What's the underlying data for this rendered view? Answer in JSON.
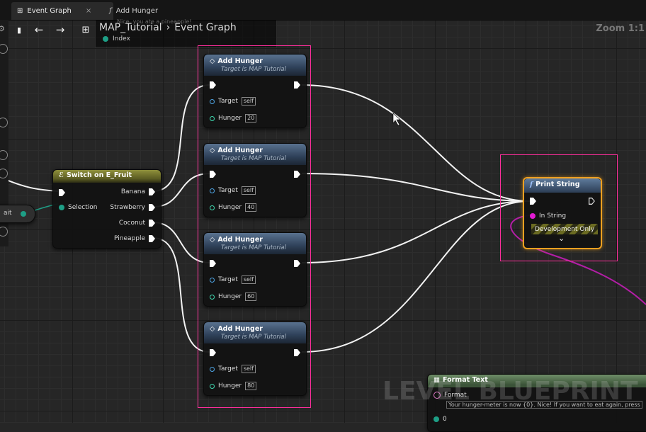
{
  "tabs": [
    {
      "label": "Event Graph",
      "close": "×"
    },
    {
      "label": "Add Hunger",
      "glyph": "f"
    }
  ],
  "breadcrumb": {
    "part1": "MAP_Tutorial",
    "separator": "›",
    "part2": "Event Graph"
  },
  "zoom": "Zoom 1:1",
  "popup": {
    "text": "Nice, you ate a pineapple!",
    "pin_label": "Index"
  },
  "left_stub": {
    "label": "ait"
  },
  "switch_node": {
    "title": "Switch on E_Fruit",
    "selection_label": "Selection",
    "outputs": [
      "Banana",
      "Strawberry",
      "Coconut",
      "Pineapple"
    ]
  },
  "add_hunger_nodes": [
    {
      "title": "Add Hunger",
      "subtitle": "Target is MAP Tutorial",
      "target_label": "Target",
      "target_value": "self",
      "hunger_label": "Hunger",
      "hunger_value": "20"
    },
    {
      "title": "Add Hunger",
      "subtitle": "Target is MAP Tutorial",
      "target_label": "Target",
      "target_value": "self",
      "hunger_label": "Hunger",
      "hunger_value": "40"
    },
    {
      "title": "Add Hunger",
      "subtitle": "Target is MAP Tutorial",
      "target_label": "Target",
      "target_value": "self",
      "hunger_label": "Hunger",
      "hunger_value": "60"
    },
    {
      "title": "Add Hunger",
      "subtitle": "Target is MAP Tutorial",
      "target_label": "Target",
      "target_value": "self",
      "hunger_label": "Hunger",
      "hunger_value": "80"
    }
  ],
  "print_string": {
    "glyph": "f",
    "title": "Print String",
    "in_string": "In String",
    "dev_only": "Development Only",
    "expand": "⌄"
  },
  "format_text": {
    "title": "Format Text",
    "format_label": "Format",
    "format_value": "Your hunger-meter is now {0}. Nice! If you want to eat again, press",
    "pin0": "0"
  },
  "watermark": "LEVEL BLUEPRINT",
  "colors": {
    "highlight": "#ff2e9c",
    "exec_wire": "#ffffff",
    "string_wire": "#b31ea6",
    "teal_wire": "#1e9f86"
  }
}
